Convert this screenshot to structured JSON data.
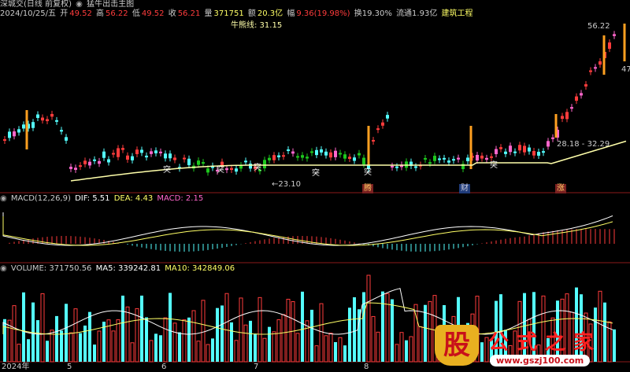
{
  "header": {
    "symbol": "深城交(日线 前复权)",
    "indicator": "猛牛出击主图",
    "date": "2024/10/25/五",
    "open_label": "开",
    "open": "49.52",
    "high_label": "高",
    "high": "56.22",
    "low_label": "低",
    "low": "49.52",
    "close_label": "收",
    "close": "56.21",
    "volume_label": "量",
    "volume": "371751",
    "amount_label": "额",
    "amount": "20.3亿",
    "change_label": "幅",
    "change": "9.36(19.98%)",
    "turnover": "换19.30%",
    "float_mcap": "流通1.93亿",
    "sector": "建筑工程",
    "bull_line": "牛熊线: 31.15"
  },
  "main_chart": {
    "price_high_label": "56.22",
    "price_47": "47",
    "low_marker": "←23.10",
    "range_label": "28.18 - 32.29",
    "tags": [
      "突",
      "突",
      "突",
      "突",
      "突",
      "突"
    ],
    "event_badges": [
      "腾",
      "财",
      "涨"
    ],
    "low_tag": "$"
  },
  "macd": {
    "title": "MACD(12,26,9)",
    "dif": "DIF: 5.51",
    "dea": "DEA: 4.43",
    "macd": "MACD: 2.15"
  },
  "volume_panel": {
    "title": "VOLUME: 371750.56",
    "ma5": "MA5: 339242.81",
    "ma10": "MA10: 342849.06"
  },
  "x_axis": [
    "2024年",
    "5",
    "6",
    "7",
    "8"
  ],
  "watermark": {
    "logo_char": "股",
    "brand": "公式之家",
    "url": "www.gszj100.com"
  },
  "colors": {
    "up": "#ff3c3c",
    "down": "#54ffff",
    "pink": "#ff66cc",
    "ma_yellow": "#ffffaa",
    "green": "#1ec81e",
    "text": "#cccccc"
  }
}
